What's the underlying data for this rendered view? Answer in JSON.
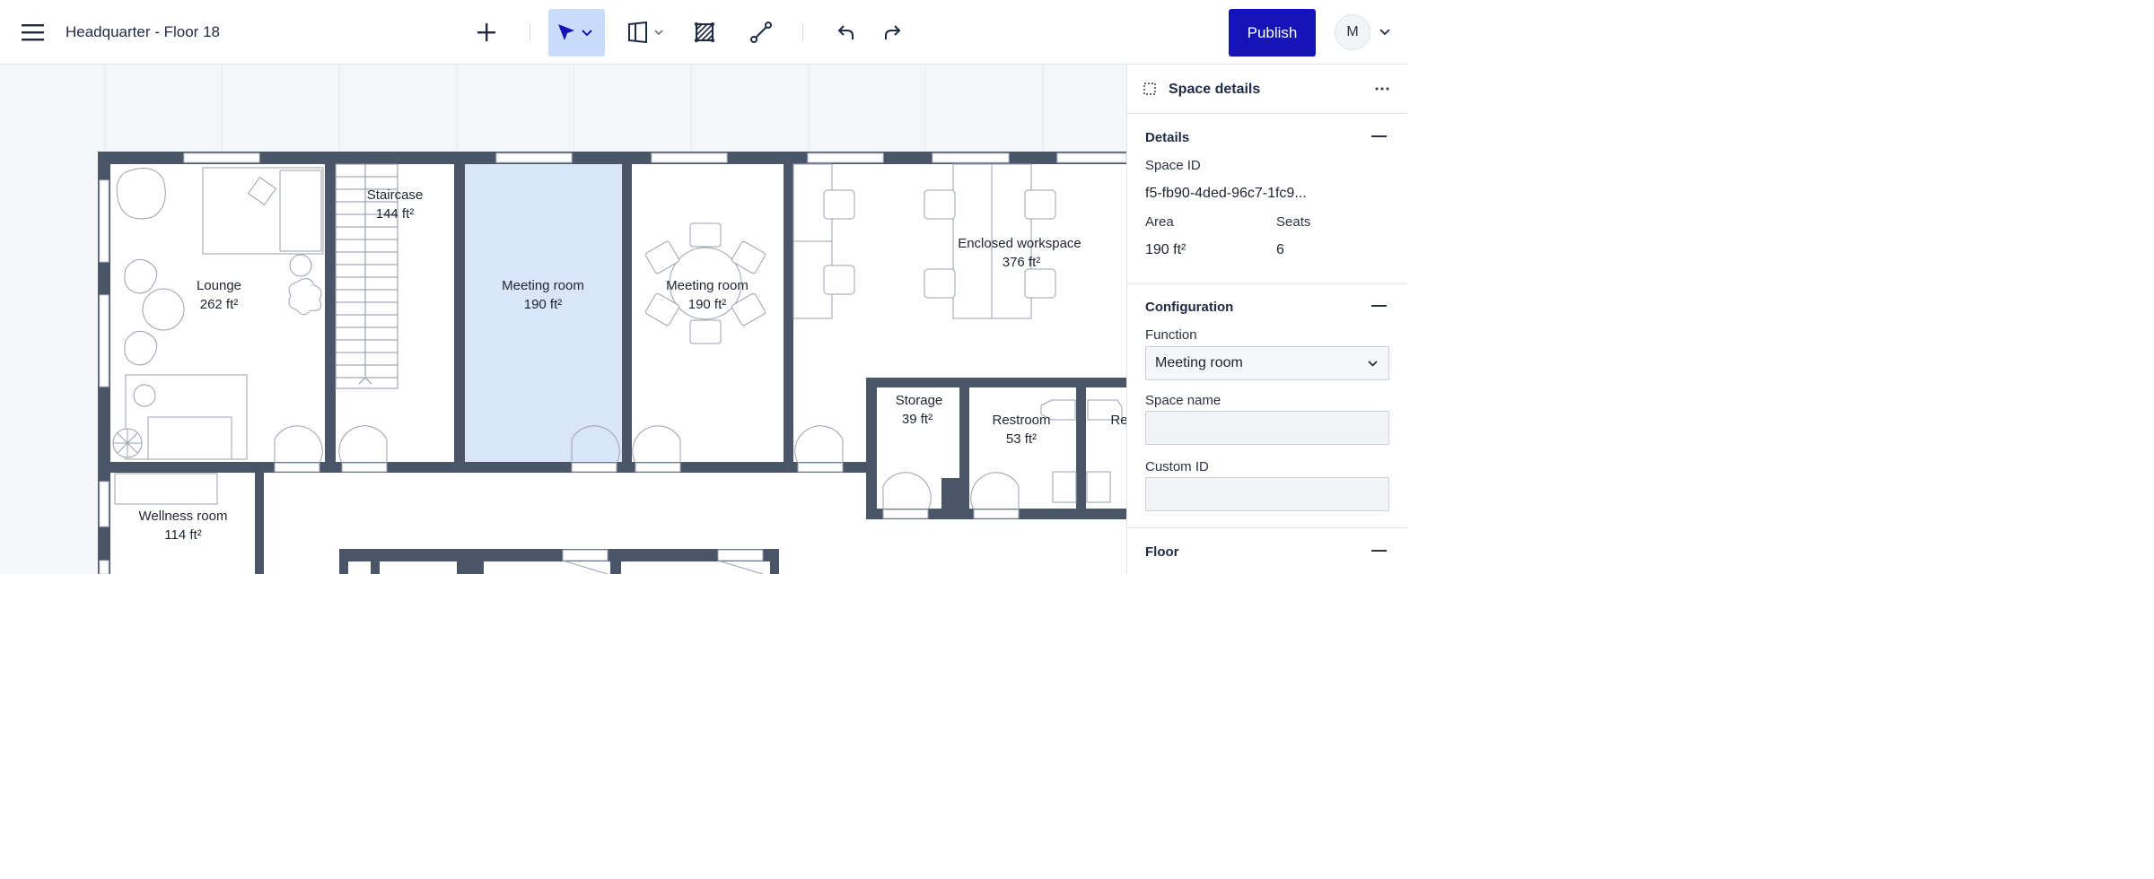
{
  "header": {
    "title": "Headquarter - Floor 18",
    "publish_label": "Publish",
    "avatar_initial": "M"
  },
  "toolbar": {
    "tools": [
      "plus-icon",
      "select-pointer-icon",
      "wall-tool-icon",
      "zone-hatch-icon",
      "line-tool-icon",
      "undo-icon",
      "redo-icon"
    ],
    "active_tool": "select-pointer-icon",
    "accent": "#1414b8",
    "active_bg": "#c9dcfb"
  },
  "floorplan": {
    "selected_fill": "#d9e6f9",
    "wall_color": "#4a5568",
    "rooms": [
      {
        "name": "Lounge",
        "area": "262 ft²"
      },
      {
        "name": "Staircase",
        "area": "144 ft²"
      },
      {
        "name": "Meeting room",
        "area": "190 ft²",
        "selected": true
      },
      {
        "name": "Meeting room",
        "area": "190 ft²"
      },
      {
        "name": "Enclosed workspace",
        "area": "376 ft²"
      },
      {
        "name": "Storage",
        "area": "39 ft²"
      },
      {
        "name": "Restroom",
        "area": "53 ft²"
      },
      {
        "name": "Re",
        "area": ""
      },
      {
        "name": "Wellness room",
        "area": "114 ft²"
      }
    ]
  },
  "panel": {
    "title": "Space details",
    "details": {
      "title": "Details",
      "space_id_label": "Space ID",
      "space_id_value": "f5-fb90-4ded-96c7-1fc9...",
      "area_label": "Area",
      "area_value": "190 ft²",
      "seats_label": "Seats",
      "seats_value": "6"
    },
    "configuration": {
      "title": "Configuration",
      "function_label": "Function",
      "function_value": "Meeting room",
      "space_name_label": "Space name",
      "space_name_value": "",
      "custom_id_label": "Custom ID",
      "custom_id_value": ""
    },
    "floor": {
      "title": "Floor"
    }
  }
}
